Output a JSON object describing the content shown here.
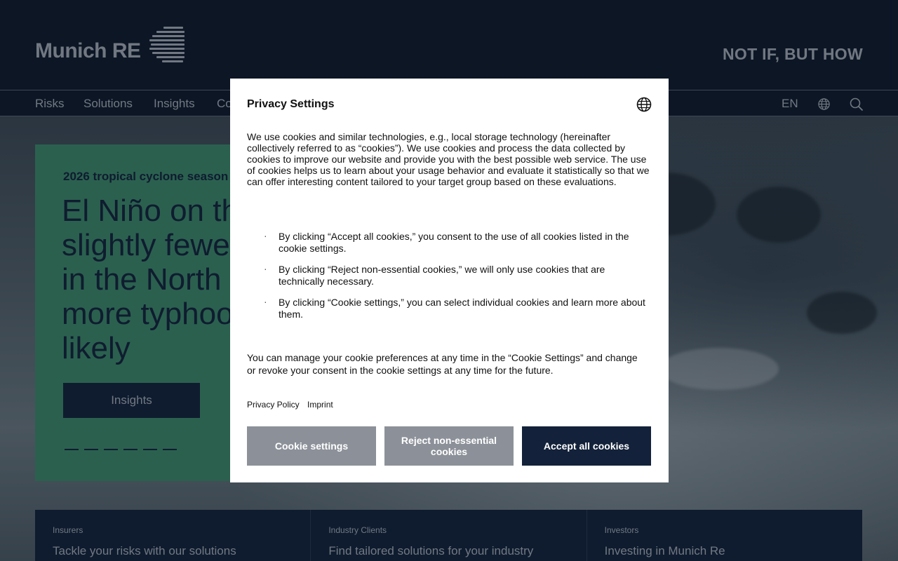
{
  "header": {
    "logo_text": "Munich RE",
    "tagline": "NOT IF, BUT HOW"
  },
  "nav": {
    "items": [
      "Risks",
      "Solutions",
      "Insights",
      "Co"
    ],
    "language": "EN"
  },
  "hero": {
    "kicker": "2026 tropical cyclone season",
    "title_lines": [
      "El Niño on th",
      "slightly fewe",
      "in the North",
      "more typhoo",
      "likely"
    ],
    "button_label": "Insights",
    "carousel_slides": 6
  },
  "tiles": [
    {
      "kicker": "Insurers",
      "title": "Tackle your risks with our solutions"
    },
    {
      "kicker": "Industry Clients",
      "title": "Find tailored solutions for your industry"
    },
    {
      "kicker": "Investors",
      "title": "Investing in Munich Re"
    }
  ],
  "privacy_modal": {
    "title": "Privacy Settings",
    "intro": "We use cookies and similar technologies, e.g., local storage technology (hereinafter collectively referred to as “cookies”). We use cookies and process the data collected by cookies to improve our website and provide you with the best possible web service. The use of cookies helps us to learn about your usage behavior and evaluate it statistically so that we can offer interesting content tailored to your target group based on these evaluations.",
    "bullets": [
      "By clicking “Accept all cookies,” you consent to the use of all cookies listed in the cookie settings.",
      "By clicking “Reject non-essential cookies,” we will only use cookies that are technically necessary.",
      "By clicking “Cookie settings,” you can select individual cookies and learn more about them."
    ],
    "manage_text": "You can manage your cookie preferences at any time in the “Cookie Settings” and change or revoke your consent in the cookie settings at any time for the future.",
    "links": [
      "Privacy Policy",
      "Imprint"
    ],
    "buttons": {
      "settings": "Cookie settings",
      "reject": "Reject non-essential cookies",
      "accept": "Accept all cookies"
    }
  },
  "colors": {
    "header_bg": "#0f1a2a",
    "accent_green": "#3e8b6a",
    "navy": "#13223a",
    "muted_text": "#a9b0b8",
    "gray_button": "#8c9199"
  },
  "icons": [
    "globe-icon",
    "search-icon",
    "language-globe-icon"
  ]
}
